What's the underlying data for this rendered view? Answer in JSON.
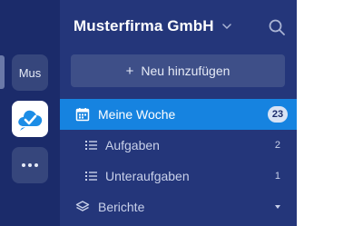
{
  "rail": {
    "workspace_abbr": "Mus",
    "app_icon": "check-cloud-icon",
    "more_icon": "more-dots-icon"
  },
  "sidebar": {
    "workspace_title": "Musterfirma GmbH",
    "add_button_label": "Neu hinzufügen",
    "items": [
      {
        "label": "Meine Woche",
        "icon": "calendar-icon",
        "badge": "23",
        "active": true
      },
      {
        "label": "Aufgaben",
        "icon": "list-icon",
        "count": "2"
      },
      {
        "label": "Unteraufgaben",
        "icon": "list-icon",
        "count": "1"
      },
      {
        "label": "Berichte",
        "icon": "layers-icon"
      }
    ]
  },
  "colors": {
    "rail_bg": "#1b2b6a",
    "panel_bg": "#24367a",
    "active_bg": "#1683e0",
    "app_icon_blue": "#1c8de6"
  }
}
